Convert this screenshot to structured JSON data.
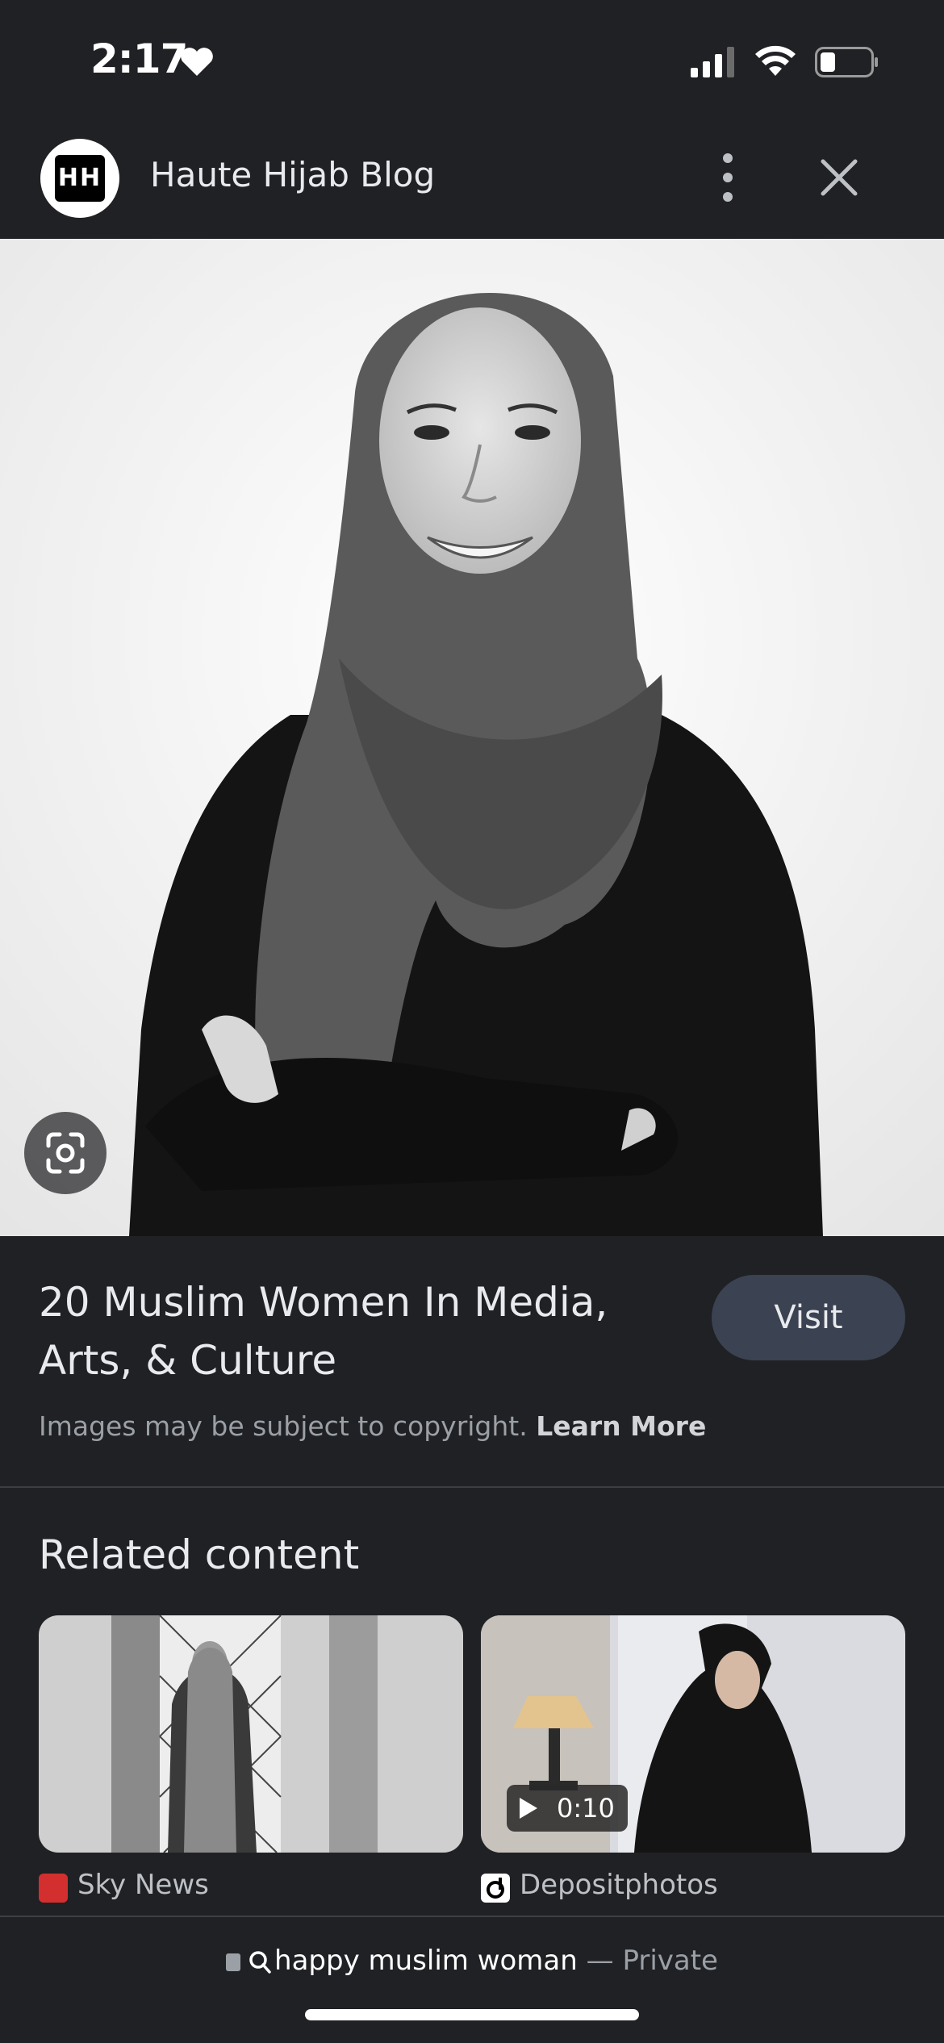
{
  "status_bar": {
    "time": "2:17"
  },
  "header": {
    "logo_text": "HH",
    "site_name": "Haute Hijab Blog"
  },
  "result": {
    "title": "20 Muslim Women In Media, Arts, & Culture",
    "visit_label": "Visit",
    "copyright_text": "Images may be subject to copyright.",
    "learn_more": "Learn More"
  },
  "related": {
    "heading": "Related content",
    "items": [
      {
        "source": "Sky News",
        "duration": ""
      },
      {
        "source": "Depositphotos",
        "duration": "0:10"
      }
    ]
  },
  "address_bar": {
    "query": "happy muslim woman",
    "separator": "—",
    "mode": "Private"
  },
  "colors": {
    "background": "#202124",
    "visit_button": "#3b4252",
    "text_muted": "#9aa0a6"
  }
}
